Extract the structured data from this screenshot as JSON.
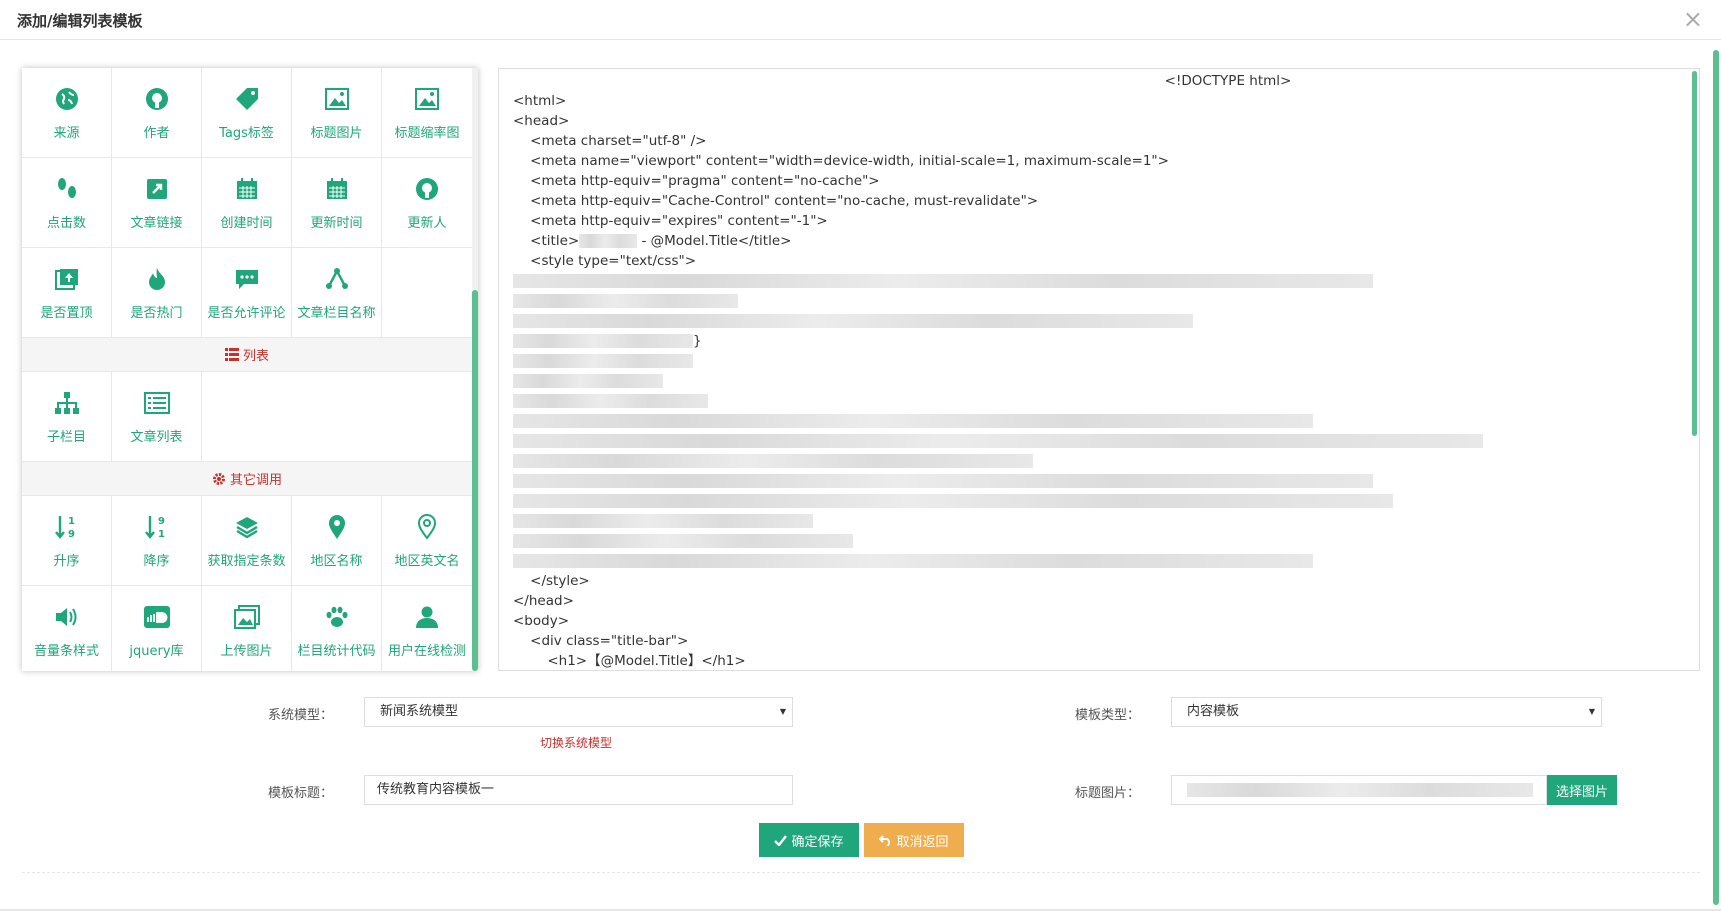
{
  "dialog": {
    "title": "添加/编辑列表模板",
    "close": "×"
  },
  "palette": {
    "row1": [
      "来源",
      "作者",
      "Tags标签",
      "标题图片",
      "标题缩率图"
    ],
    "row2": [
      "点击数",
      "文章链接",
      "创建时间",
      "更新时间",
      "更新人"
    ],
    "row3": [
      "是否置顶",
      "是否热门",
      "是否允许评论",
      "文章栏目名称"
    ],
    "section_list": "列表",
    "row4": [
      "子栏目",
      "文章列表"
    ],
    "section_other": "其它调用",
    "row5": [
      "升序",
      "降序",
      "获取指定条数",
      "地区名称",
      "地区英文名"
    ],
    "row6": [
      "音量条样式",
      "jquery库",
      "上传图片",
      "栏目统计代码",
      "用户在线检测"
    ]
  },
  "editor": {
    "lines": [
      "<!DOCTYPE html>",
      "<html>",
      "<head>",
      "    <meta charset=\"utf-8\" />",
      "    <meta name=\"viewport\" content=\"width=device-width, initial-scale=1, maximum-scale=1\">",
      "    <meta http-equiv=\"pragma\" content=\"no-cache\">",
      "    <meta http-equiv=\"Cache-Control\" content=\"no-cache, must-revalidate\">",
      "    <meta http-equiv=\"expires\" content=\"-1\">",
      "    <title>",
      " - @Model.Title</title>",
      "    <style type=\"text/css\">",
      "}",
      "    </style>",
      "</head>",
      "<body>",
      "    <div class=\"title-bar\">",
      "        <h1>【@Model.Title】</h1>"
    ]
  },
  "form": {
    "system_model_label": "系统模型：",
    "system_model_value": "新闻系统模型",
    "switch_hint": "切换系统模型",
    "template_type_label": "模板类型：",
    "template_type_value": "内容模板",
    "template_title_label": "模板标题：",
    "template_title_value": "传统教育内容模板一",
    "title_image_label": "标题图片：",
    "pick_image_button": "选择图片",
    "save_button": "确定保存",
    "cancel_button": "取消返回"
  },
  "colors": {
    "accent": "#1fa67a",
    "warning": "#f0ad4e",
    "danger": "#c9302c"
  }
}
